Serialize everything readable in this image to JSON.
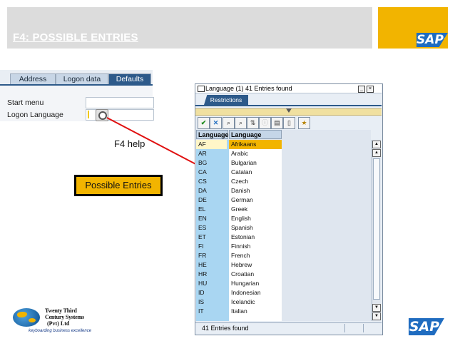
{
  "slide": {
    "title": "F4: POSSIBLE ENTRIES",
    "brand": "SAP",
    "brand_color": "#1f6cc0",
    "accent_color": "#f2b400"
  },
  "tabs_window": {
    "tabs": [
      {
        "label": "Address",
        "active": false
      },
      {
        "label": "Logon data",
        "active": false
      },
      {
        "label": "Defaults",
        "active": true
      }
    ],
    "fields": [
      {
        "label": "Start menu",
        "value": ""
      },
      {
        "label": "Logon Language",
        "value": ""
      }
    ],
    "f4_icon": "search-help-icon"
  },
  "annotations": {
    "f4_help": "F4 help",
    "possible_entries": "Possible Entries"
  },
  "popup": {
    "title": "Language (1)   41 Entries found",
    "restrictions_tab": "Restrictions",
    "toolbar_icons": [
      "check-icon",
      "cancel-icon",
      "find-icon",
      "find-next-icon",
      "sort-icon",
      "info-icon",
      "print-icon",
      "details-icon",
      "personal-list-icon"
    ],
    "columns": [
      "Language",
      "Language"
    ],
    "rows": [
      {
        "code": "AF",
        "name": "Afrikaans",
        "selected": true
      },
      {
        "code": "AR",
        "name": "Arabic"
      },
      {
        "code": "BG",
        "name": "Bulgarian"
      },
      {
        "code": "CA",
        "name": "Catalan"
      },
      {
        "code": "CS",
        "name": "Czech"
      },
      {
        "code": "DA",
        "name": "Danish"
      },
      {
        "code": "DE",
        "name": "German"
      },
      {
        "code": "EL",
        "name": "Greek"
      },
      {
        "code": "EN",
        "name": "English"
      },
      {
        "code": "ES",
        "name": "Spanish"
      },
      {
        "code": "ET",
        "name": "Estonian"
      },
      {
        "code": "FI",
        "name": "Finnish"
      },
      {
        "code": "FR",
        "name": "French"
      },
      {
        "code": "HE",
        "name": "Hebrew"
      },
      {
        "code": "HR",
        "name": "Croatian"
      },
      {
        "code": "HU",
        "name": "Hungarian"
      },
      {
        "code": "ID",
        "name": "Indonesian"
      },
      {
        "code": "IS",
        "name": "Icelandic"
      },
      {
        "code": "IT",
        "name": "Italian"
      }
    ],
    "status": "41 Entries found"
  },
  "company": {
    "line1": "Twenty Third",
    "line2": "Century Systems",
    "line3": "(Pvt) Ltd",
    "tagline": "keyboarding business excellence"
  }
}
